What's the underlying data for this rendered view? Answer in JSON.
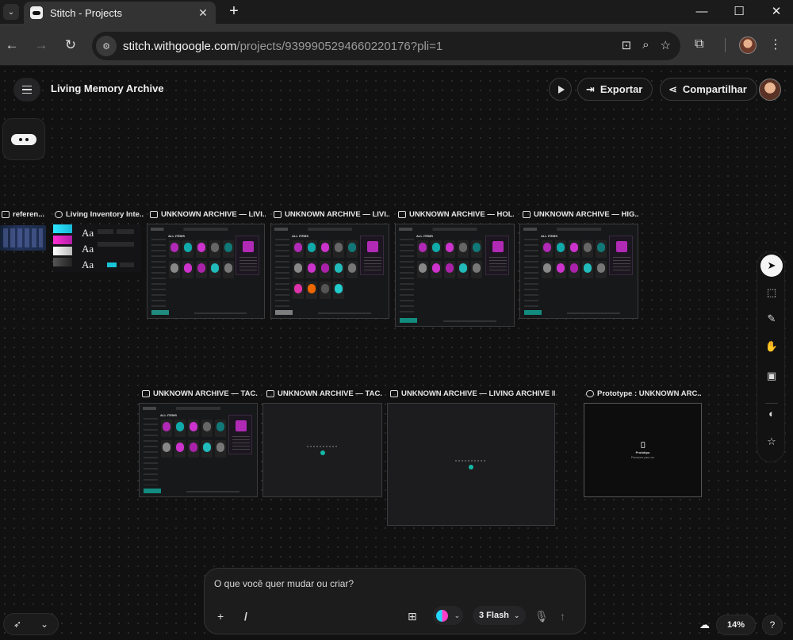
{
  "browser": {
    "tab_title": "Stitch - Projects",
    "url_host": "stitch.withgoogle.com",
    "url_path": "/projects/9399905294660220176?pli=1"
  },
  "header": {
    "project_title": "Living Memory Archive",
    "export_label": "Exportar",
    "share_label": "Compartilhar"
  },
  "frames": {
    "reference_label": "referen...",
    "style_label": "Living Inventory Inte...",
    "row1": [
      "UNKNOWN ARCHIVE — LIVI...",
      "UNKNOWN ARCHIVE — LIVI...",
      "UNKNOWN ARCHIVE — HOL...",
      "UNKNOWN ARCHIVE — HIG..."
    ],
    "row2": [
      "UNKNOWN ARCHIVE — TAC...",
      "UNKNOWN ARCHIVE — TAC...",
      "UNKNOWN ARCHIVE — LIVING ARCHIVE IN...",
      "Prototype : UNKNOWN ARC..."
    ],
    "mini_title": "ALL ITEMS",
    "proto_title": "Protótipo",
    "proto_sub": "Pressione para ver"
  },
  "prompt": {
    "placeholder": "O que você quer mudar ou criar?",
    "slash": "/",
    "model": "3 Flash"
  },
  "zoom": "14%",
  "help": "?",
  "colors": {
    "accent_magenta": "#b02ab5",
    "accent_teal": "#14b8a6"
  }
}
